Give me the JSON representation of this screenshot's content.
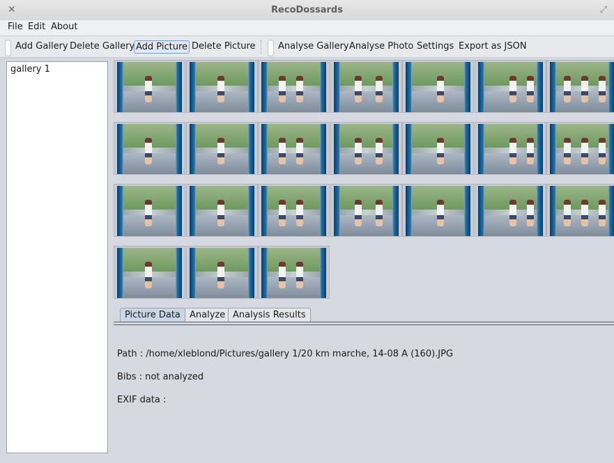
{
  "window": {
    "title": "RecoDossards"
  },
  "menu": [
    "File",
    "Edit",
    "About"
  ],
  "toolbar": {
    "add_gallery": "Add Gallery",
    "delete_gallery": "Delete Gallery",
    "add_picture": "Add Picture",
    "delete_picture": "Delete Picture",
    "analyse_gallery": "Analyse Gallery",
    "analyse_photo": "Analyse Photo",
    "settings": "Settings",
    "export_json": "Export as JSON"
  },
  "galleries": [
    "gallery 1"
  ],
  "thumbnails": {
    "count": 24
  },
  "tabs": [
    "Picture Data",
    "Analyze",
    "Analysis Results"
  ],
  "picture_data": {
    "path": "Path : /home/xleblond/Pictures/gallery 1/20 km marche, 14-08 A (160).JPG",
    "bibs": "Bibs : not analyzed",
    "exif": "EXIF data :"
  },
  "icons": {
    "close": "close-icon",
    "maximize": "maximize-icon"
  }
}
